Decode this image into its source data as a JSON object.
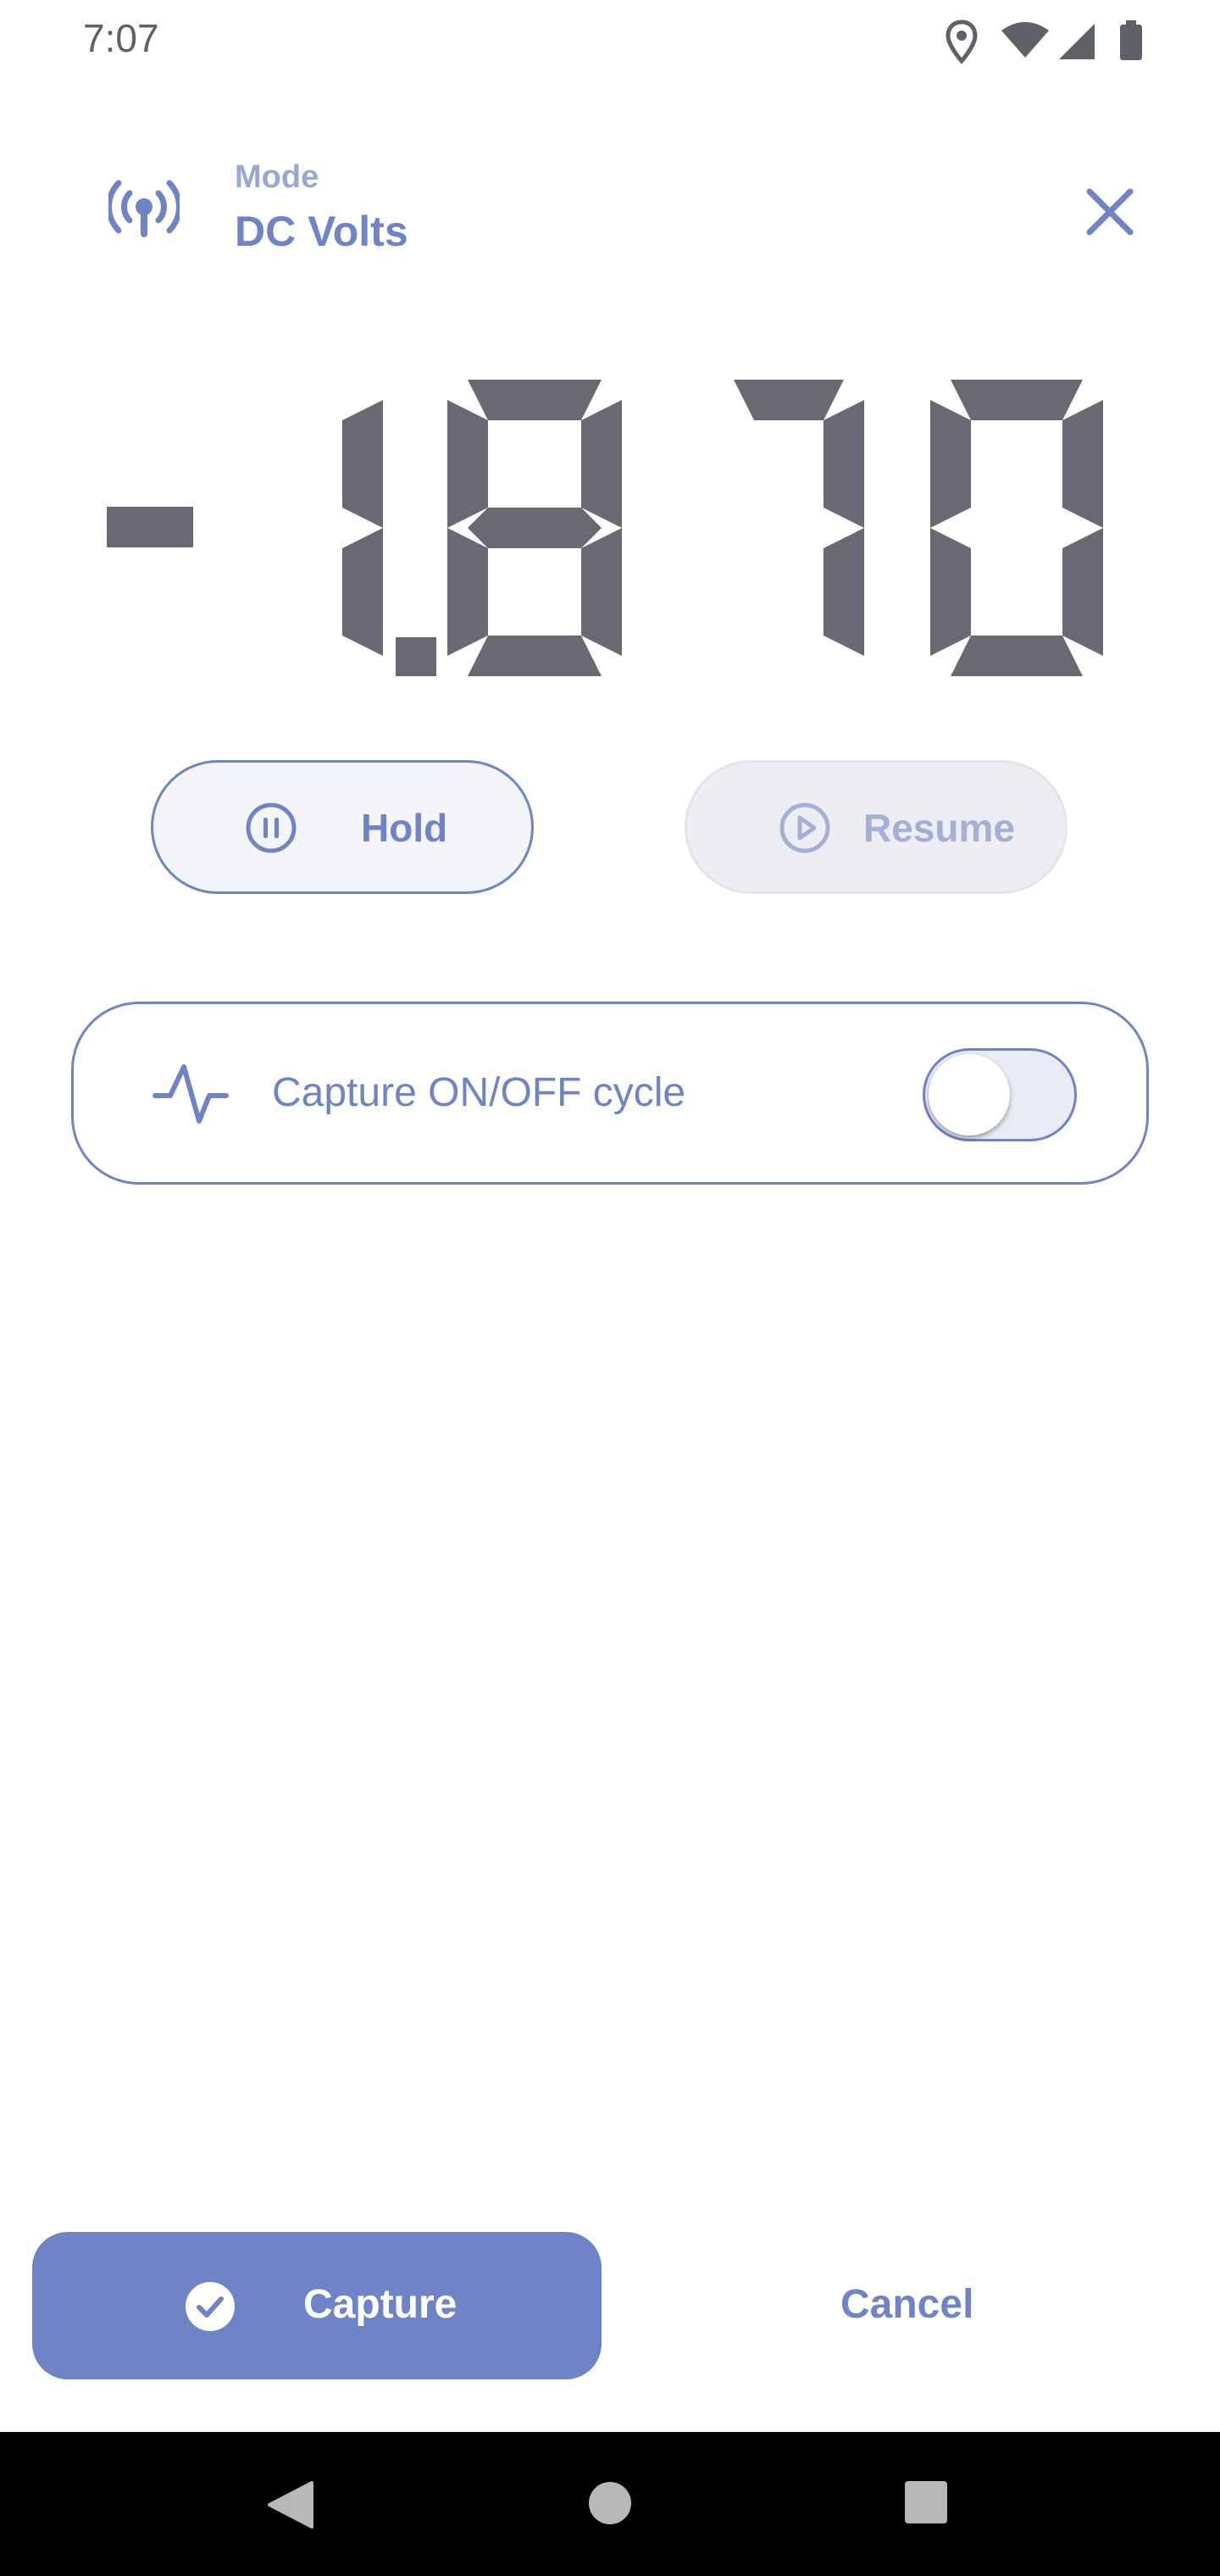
{
  "status_bar": {
    "time": "7:07",
    "icons": [
      "location-icon",
      "wifi-icon",
      "cell-signal-icon",
      "battery-icon"
    ]
  },
  "header": {
    "mode_label": "Mode",
    "mode_value": "DC Volts",
    "mode_icon": "broadcast-icon",
    "close_icon": "close-icon"
  },
  "reading": {
    "value": "-1.870",
    "sign": "-",
    "digits": [
      "1",
      "8",
      "7",
      "0"
    ],
    "decimal_after_digit": 1
  },
  "controls": {
    "hold_label": "Hold",
    "resume_label": "Resume"
  },
  "cycle": {
    "label": "Capture ON/OFF cycle",
    "enabled": false
  },
  "actions": {
    "capture_label": "Capture",
    "cancel_label": "Cancel"
  },
  "colors": {
    "accent": "#6f84c6",
    "accent_light": "#9aa7d4",
    "digit": "#696874",
    "nav_bar": "#000000"
  }
}
